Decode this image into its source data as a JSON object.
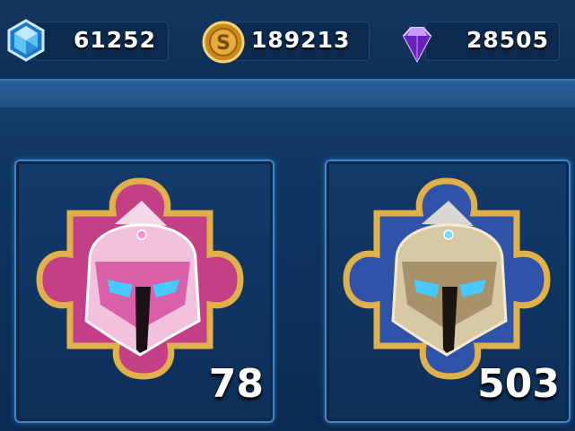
{
  "currencies": [
    {
      "name": "crystal",
      "icon": "blue-crystal-icon",
      "value": "61252"
    },
    {
      "name": "gold",
      "icon": "gold-coin-icon",
      "value": "189213"
    },
    {
      "name": "gem",
      "icon": "purple-gem-icon",
      "value": "28505"
    }
  ],
  "items": [
    {
      "name": "pink-helmet-fragment",
      "icon": "pink-knight-helmet-icon",
      "count": "78",
      "color": "#d45fa2"
    },
    {
      "name": "gold-helmet-fragment",
      "icon": "gold-knight-helmet-icon",
      "count": "503",
      "color": "#c9b48a"
    }
  ],
  "colors": {
    "accent": "#3f86c7",
    "gold": "#d9a441"
  }
}
